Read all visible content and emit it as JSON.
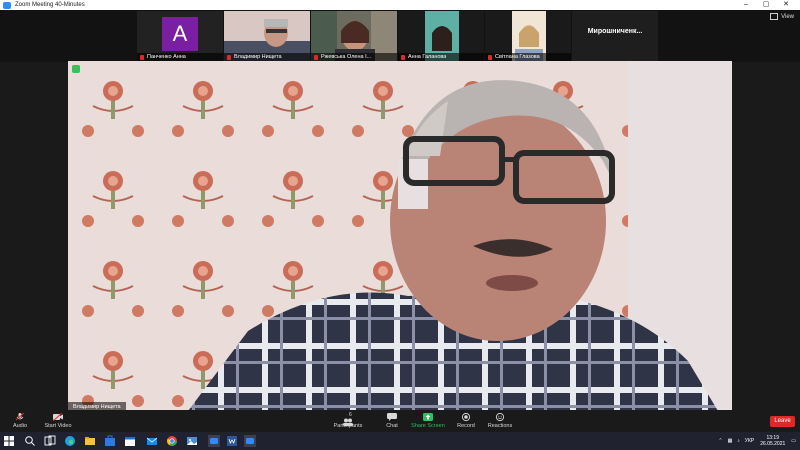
{
  "window": {
    "title": "Zoom Meeting 40-Minutes",
    "controls": [
      "–",
      "▢",
      "✕"
    ]
  },
  "strip": {
    "tiles": [
      {
        "name": "Панченко Анна",
        "avatar_letter": "A"
      },
      {
        "name": "Владимир Нищета"
      },
      {
        "name": "Ржевська Олена І..."
      },
      {
        "name": "Анна Галанова"
      },
      {
        "name": "Світлана Глазова"
      },
      {
        "name": "Мирошниченк..."
      }
    ],
    "view_label": "View"
  },
  "speaker": {
    "name": "Владимир Нищета"
  },
  "toolbar": {
    "audio": "Audio",
    "start_video": "Start Video",
    "participants": "Participants",
    "participants_count": "6",
    "chat": "Chat",
    "share_screen": "Share Screen",
    "record": "Record",
    "reactions": "Reactions",
    "leave": "Leave"
  },
  "taskbar": {
    "lang": "УКР",
    "time": "13:19",
    "date": "26.05.2021"
  },
  "colors": {
    "accent_green": "#22c55e",
    "leave_red": "#e02828",
    "avatar_purple": "#7a1fa2"
  }
}
